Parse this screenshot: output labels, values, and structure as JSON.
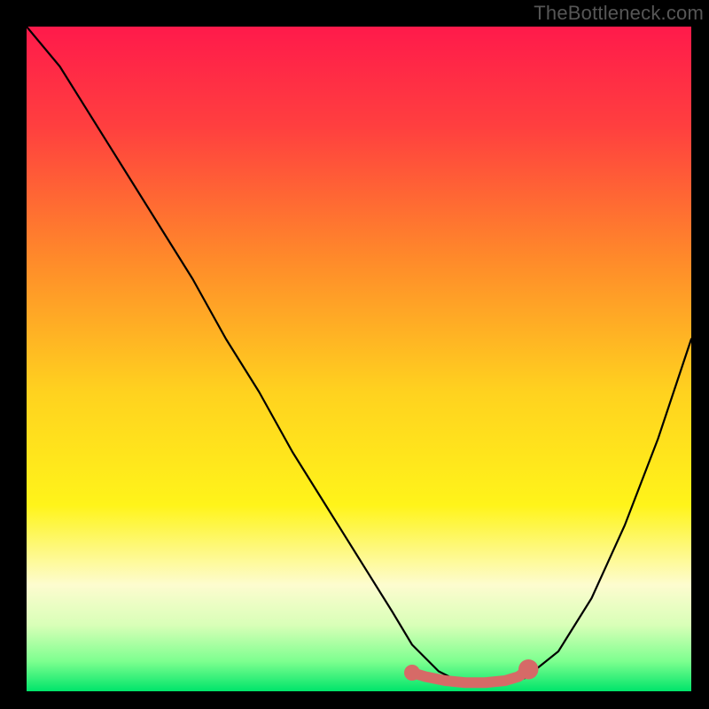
{
  "watermark": "TheBottleneck.com",
  "chart_data": {
    "type": "line",
    "title": "",
    "xlabel": "",
    "ylabel": "",
    "xlim": [
      0,
      100
    ],
    "ylim": [
      0,
      100
    ],
    "grid": false,
    "legend": false,
    "gradient_stops": [
      {
        "offset": 0.0,
        "color": "#ff1a4b"
      },
      {
        "offset": 0.15,
        "color": "#ff3f3f"
      },
      {
        "offset": 0.35,
        "color": "#ff8a2a"
      },
      {
        "offset": 0.55,
        "color": "#ffd21f"
      },
      {
        "offset": 0.72,
        "color": "#fff41a"
      },
      {
        "offset": 0.84,
        "color": "#fdfccf"
      },
      {
        "offset": 0.9,
        "color": "#d9ffb8"
      },
      {
        "offset": 0.955,
        "color": "#7dff8f"
      },
      {
        "offset": 1.0,
        "color": "#00e46a"
      }
    ],
    "series": [
      {
        "name": "curve",
        "color": "#000000",
        "x": [
          0,
          5,
          10,
          15,
          20,
          25,
          30,
          35,
          40,
          45,
          50,
          55,
          58,
          62,
          66,
          70,
          75,
          80,
          85,
          90,
          95,
          100
        ],
        "y": [
          100,
          94,
          86,
          78,
          70,
          62,
          53,
          45,
          36,
          28,
          20,
          12,
          7,
          3,
          1,
          1,
          2,
          6,
          14,
          25,
          38,
          53
        ]
      },
      {
        "name": "sweet-spot",
        "color": "#d66a67",
        "x": [
          58,
          60,
          63,
          66,
          69,
          72,
          74,
          75.5
        ],
        "y": [
          2.8,
          2.2,
          1.6,
          1.3,
          1.3,
          1.6,
          2.2,
          3.3
        ]
      }
    ],
    "markers": [
      {
        "name": "sweet-spot-start",
        "x": 58,
        "y": 2.8,
        "r": 1.2,
        "color": "#d66a67"
      },
      {
        "name": "sweet-spot-end",
        "x": 75.5,
        "y": 3.3,
        "r": 1.5,
        "color": "#d66a67"
      }
    ]
  }
}
